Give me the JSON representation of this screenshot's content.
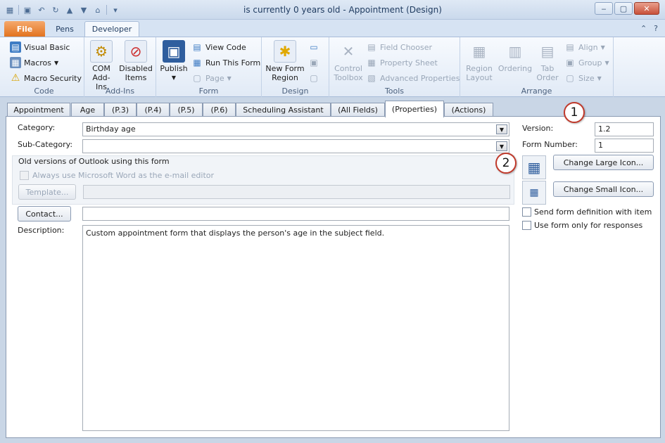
{
  "window": {
    "title": "is currently 0 years old  -  Appointment   (Design)"
  },
  "ribbon_tabs": {
    "file": "File",
    "pens": "Pens",
    "developer": "Developer"
  },
  "groups": {
    "code": {
      "label": "Code",
      "visual_basic": "Visual Basic",
      "macros": "Macros",
      "macro_security": "Macro Security"
    },
    "addins": {
      "label": "Add-Ins",
      "com_addins_line1": "COM",
      "com_addins_line2": "Add-Ins",
      "disabled_line1": "Disabled",
      "disabled_line2": "Items"
    },
    "form": {
      "label": "Form",
      "publish": "Publish",
      "view_code": "View Code",
      "run_this_form": "Run This Form",
      "page": "Page"
    },
    "design": {
      "label": "Design",
      "new_form_region_line1": "New Form",
      "new_form_region_line2": "Region"
    },
    "tools": {
      "label": "Tools",
      "control_line1": "Control",
      "control_line2": "Toolbox",
      "field_chooser": "Field Chooser",
      "property_sheet": "Property Sheet",
      "advanced_properties": "Advanced Properties"
    },
    "arrange": {
      "label": "Arrange",
      "region_line1": "Region",
      "region_line2": "Layout",
      "ordering": "Ordering",
      "tab_line1": "Tab",
      "tab_line2": "Order",
      "align": "Align",
      "group": "Group",
      "size": "Size"
    }
  },
  "form_tabs": [
    "Appointment",
    "Age",
    "(P.3)",
    "(P.4)",
    "(P.5)",
    "(P.6)",
    "Scheduling Assistant",
    "(All Fields)",
    "(Properties)",
    "(Actions)"
  ],
  "properties": {
    "category_label": "Category:",
    "category_value": "Birthday age",
    "subcategory_label": "Sub-Category:",
    "subcategory_value": "",
    "old_versions_heading": "Old versions of Outlook using this form",
    "always_word_label": "Always use Microsoft Word as the e-mail editor",
    "template_button": "Template...",
    "contact_button": "Contact...",
    "contact_value": "",
    "description_label": "Description:",
    "description_value": "Custom appointment form that displays the person's age in the subject field.",
    "version_label": "Version:",
    "version_value": "1.2",
    "form_number_label": "Form Number:",
    "form_number_value": "1",
    "change_large_icon": "Change Large Icon...",
    "change_small_icon": "Change Small Icon...",
    "send_form_def": "Send form definition with item",
    "use_for_responses": "Use form only for responses"
  },
  "callouts": [
    "1",
    "2"
  ]
}
